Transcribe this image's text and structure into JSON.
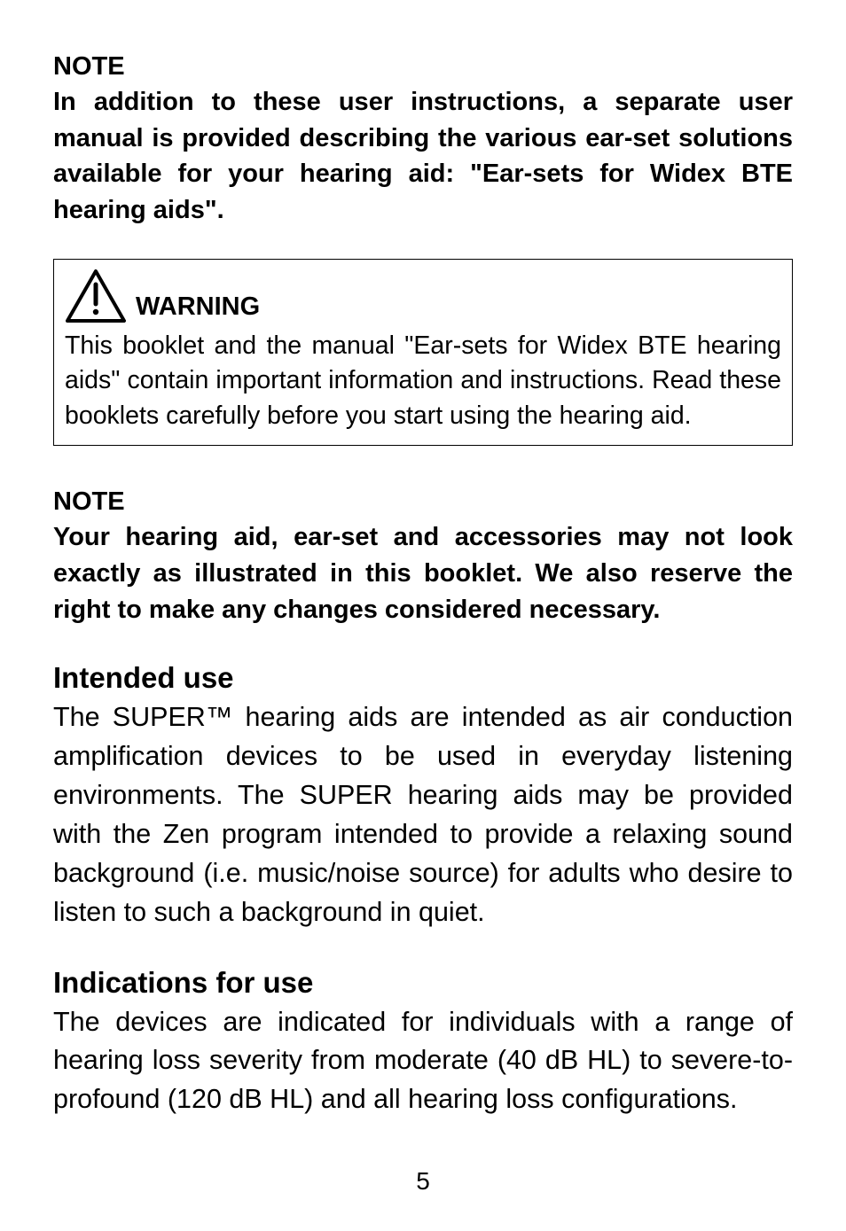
{
  "note1": {
    "title": "NOTE",
    "body": "In addition to these user instructions, a separate user manual is provided describing the various ear-set solutions available for your hearing aid: \"Ear-sets for Widex BTE hearing aids\"."
  },
  "warning": {
    "icon_name": "warning-triangle-icon",
    "title": "WARNING",
    "body": "This booklet and the manual \"Ear-sets for Widex BTE hearing aids\" contain important information and instructions. Read these booklets carefully before you start using the hearing aid."
  },
  "note2": {
    "title": "NOTE",
    "body": "Your hearing aid, ear-set and accessories may not look exactly as illustrated in this booklet. We also reserve the right to make any changes considered necessary."
  },
  "section1": {
    "title": "Intended use",
    "body": "The SUPER™ hearing aids are intended as air conduction amplification devices to be used in everyday listening environments. The SUPER hearing aids may be provided with the Zen program intended to provide a relaxing sound background (i.e. music/noise source) for adults who desire to listen to such a background in quiet."
  },
  "section2": {
    "title": "Indications for use",
    "body": "The devices are indicated for individuals with a range of hearing loss severity from moderate (40 dB HL) to severe-to-profound (120 dB HL) and all hearing loss configurations."
  },
  "page_number": "5"
}
